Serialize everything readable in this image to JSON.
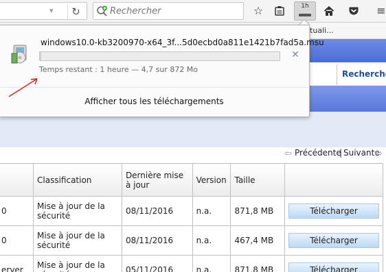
{
  "toolbar": {
    "search_placeholder": "Rechercher",
    "download_time": "1h"
  },
  "bookmarks": {
    "visible_text": "ituali..."
  },
  "page": {
    "search_tab_label": "Rechercher",
    "pager_prev": "Précédente",
    "pager_sep": "|",
    "pager_next": "Suivante",
    "table": {
      "headers": [
        "",
        "Classification",
        "Dernière mise à jour",
        "Version",
        "Taille",
        ""
      ],
      "rows": [
        {
          "prefix": "0",
          "classification": "Mise à jour de la sécurité",
          "date": "08/11/2016",
          "version": "n.a.",
          "size": "871,8 MB",
          "action": "Télécharger"
        },
        {
          "prefix": "0",
          "classification": "Mise à jour de la sécurité",
          "date": "08/11/2016",
          "version": "n.a.",
          "size": "467,4 MB",
          "action": "Télécharger"
        },
        {
          "prefix": "erver",
          "classification": "Mise à jour de la sécurité",
          "date": "05/11/2016",
          "version": "n.a.",
          "size": "871,8 MB",
          "action": "Télécharger"
        }
      ]
    }
  },
  "downloads_panel": {
    "file_name": "windows10.0-kb3200970-x64_3f...5d0ecbd0a811e1421b7fad5a.msu",
    "status": "Temps restant : 1 heure — 4,7 sur 872 Mo",
    "progress": 0.0054,
    "show_all_label": "Afficher tous les téléchargements"
  }
}
